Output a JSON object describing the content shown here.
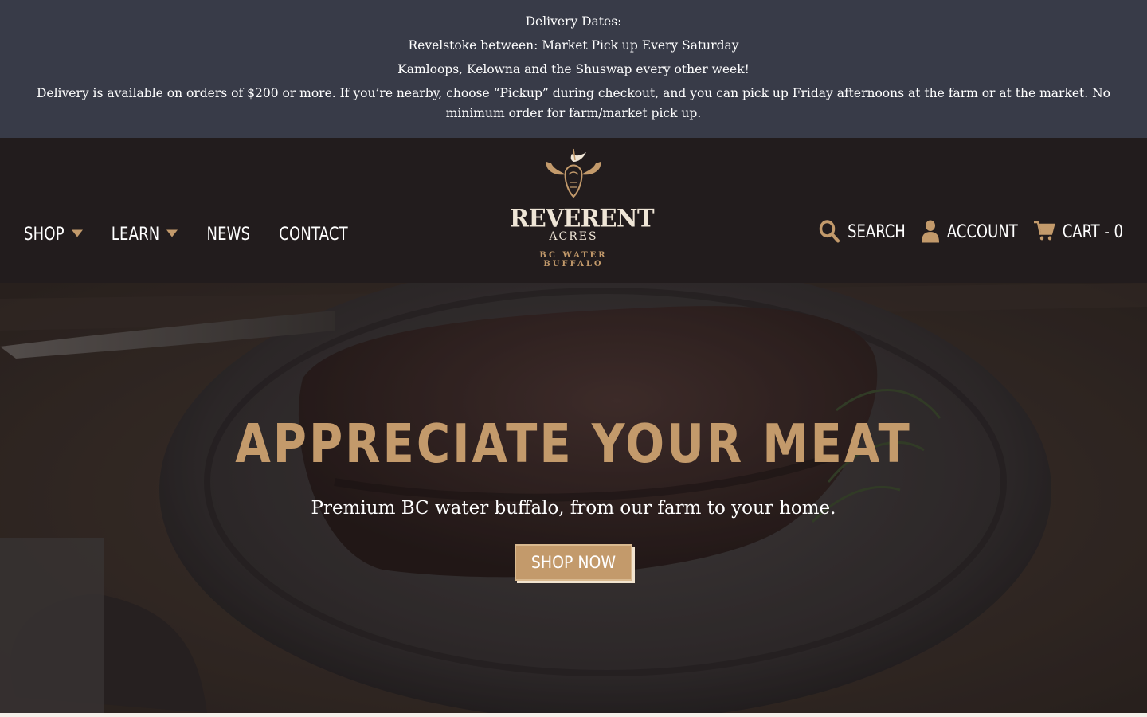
{
  "announcement": {
    "line1": "Delivery Dates:",
    "line2": "Revelstoke between: Market Pick up Every Saturday",
    "line3": "Kamloops, Kelowna and the Shuswap every other week!",
    "line4": "Delivery is available on orders of $200 or more. If you’re nearby, choose “Pickup” during checkout, and you can pick up Friday afternoons at the farm or at the market. No minimum order for farm/market pick up."
  },
  "nav": {
    "shop": "SHOP",
    "learn": "LEARN",
    "news": "NEWS",
    "contact": "CONTACT"
  },
  "logo": {
    "brand": "REVERENT",
    "brand2": "ACRES",
    "tagline": "BC WATER BUFFALO"
  },
  "utility": {
    "search": "SEARCH",
    "account": "ACCOUNT",
    "cart": "CART - 0"
  },
  "hero": {
    "title": "APPRECIATE YOUR MEAT",
    "subtitle": "Premium BC water buffalo, from our farm to your home.",
    "button": "SHOP NOW"
  },
  "colors": {
    "accent": "#c39a6b",
    "announce_bg": "#383b48",
    "header_bg": "#221c1d"
  }
}
